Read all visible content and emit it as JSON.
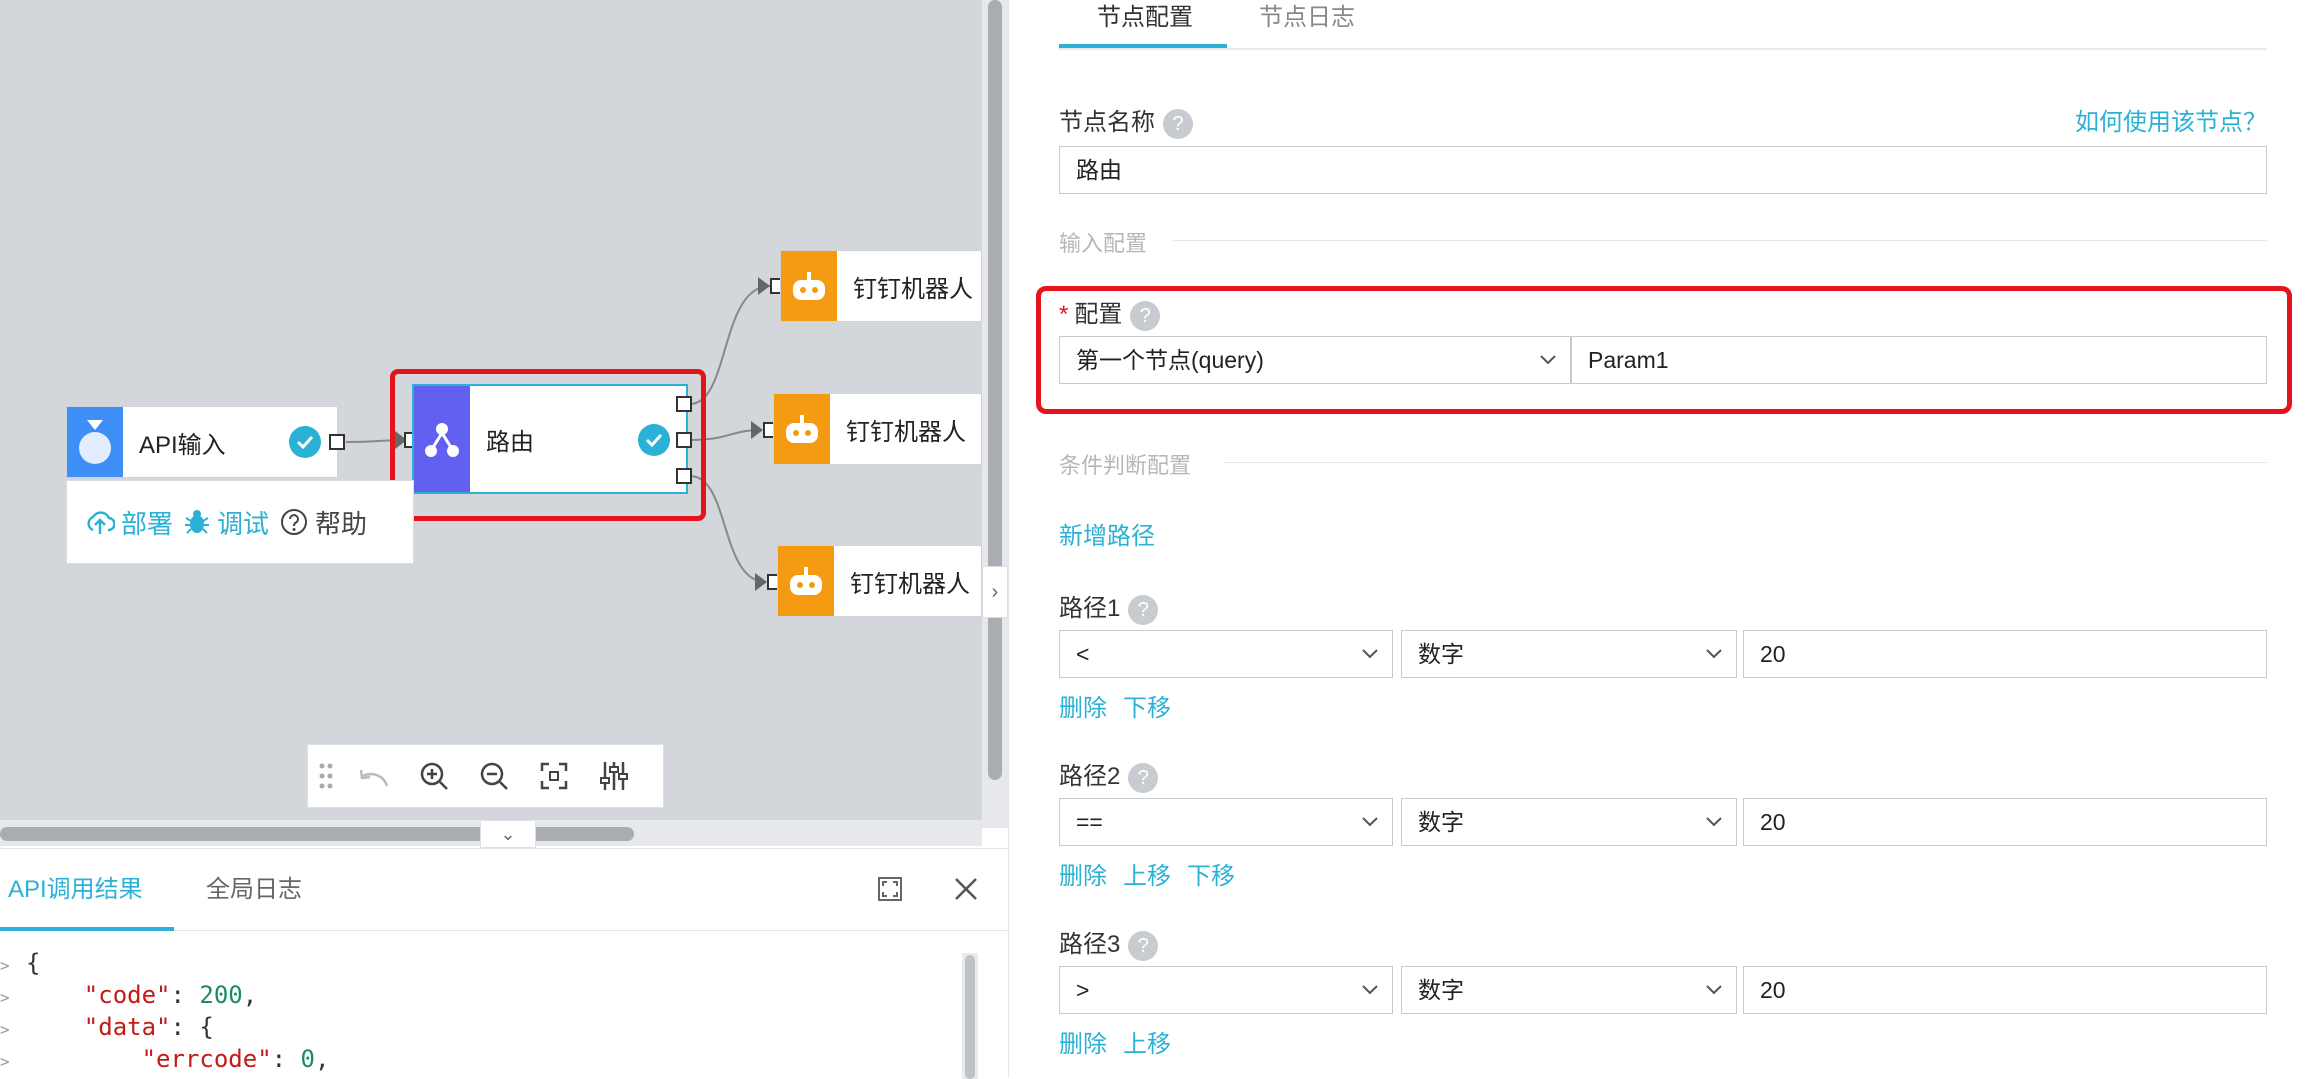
{
  "canvas": {
    "nodes": {
      "api_input": {
        "label": "API输入"
      },
      "router": {
        "label": "路由"
      },
      "bots": [
        {
          "label": "钉钉机器人"
        },
        {
          "label": "钉钉机器人"
        },
        {
          "label": "钉钉机器人"
        }
      ]
    },
    "node_menu": {
      "deploy_label": "部署",
      "debug_label": "调试",
      "help_label": "帮助"
    },
    "toolbar": {
      "icons": [
        "drag-handle-icon",
        "undo-icon",
        "zoom-in-icon",
        "zoom-out-icon",
        "fit-screen-icon",
        "settings-sliders-icon"
      ]
    }
  },
  "bottom_panel": {
    "tabs": [
      {
        "label": "API调用结果",
        "active": true
      },
      {
        "label": "全局日志",
        "active": false
      }
    ],
    "code_lines": [
      {
        "text": "{"
      },
      {
        "key": "\"code\"",
        "sep": ": ",
        "val": "200",
        "tail": ","
      },
      {
        "key": "\"data\"",
        "sep": ": ",
        "val": "",
        "tail": "{"
      },
      {
        "key": "\"errcode\"",
        "sep": ": ",
        "val": "0",
        "tail": ","
      }
    ]
  },
  "config_panel": {
    "tabs": [
      {
        "label": "节点配置",
        "active": true
      },
      {
        "label": "节点日志",
        "active": false
      }
    ],
    "node_name_label": "节点名称",
    "how_to_link": "如何使用该节点？",
    "node_name_value": "路由",
    "input_section_title": "输入配置",
    "config_label": "配置",
    "config_select_value": "第一个节点(query)",
    "config_param_value": "Param1",
    "condition_section_title": "条件判断配置",
    "add_route_link": "新增路径",
    "routes": [
      {
        "label": "路径1",
        "operator": "<",
        "type": "数字",
        "value": "20",
        "actions": [
          "删除",
          "下移"
        ]
      },
      {
        "label": "路径2",
        "operator": "==",
        "type": "数字",
        "value": "20",
        "actions": [
          "删除",
          "上移",
          "下移"
        ]
      },
      {
        "label": "路径3",
        "operator": ">",
        "type": "数字",
        "value": "20",
        "actions": [
          "删除",
          "上移"
        ]
      }
    ],
    "accent_color": "#2bb1d6",
    "highlight_color": "#e5141c"
  }
}
